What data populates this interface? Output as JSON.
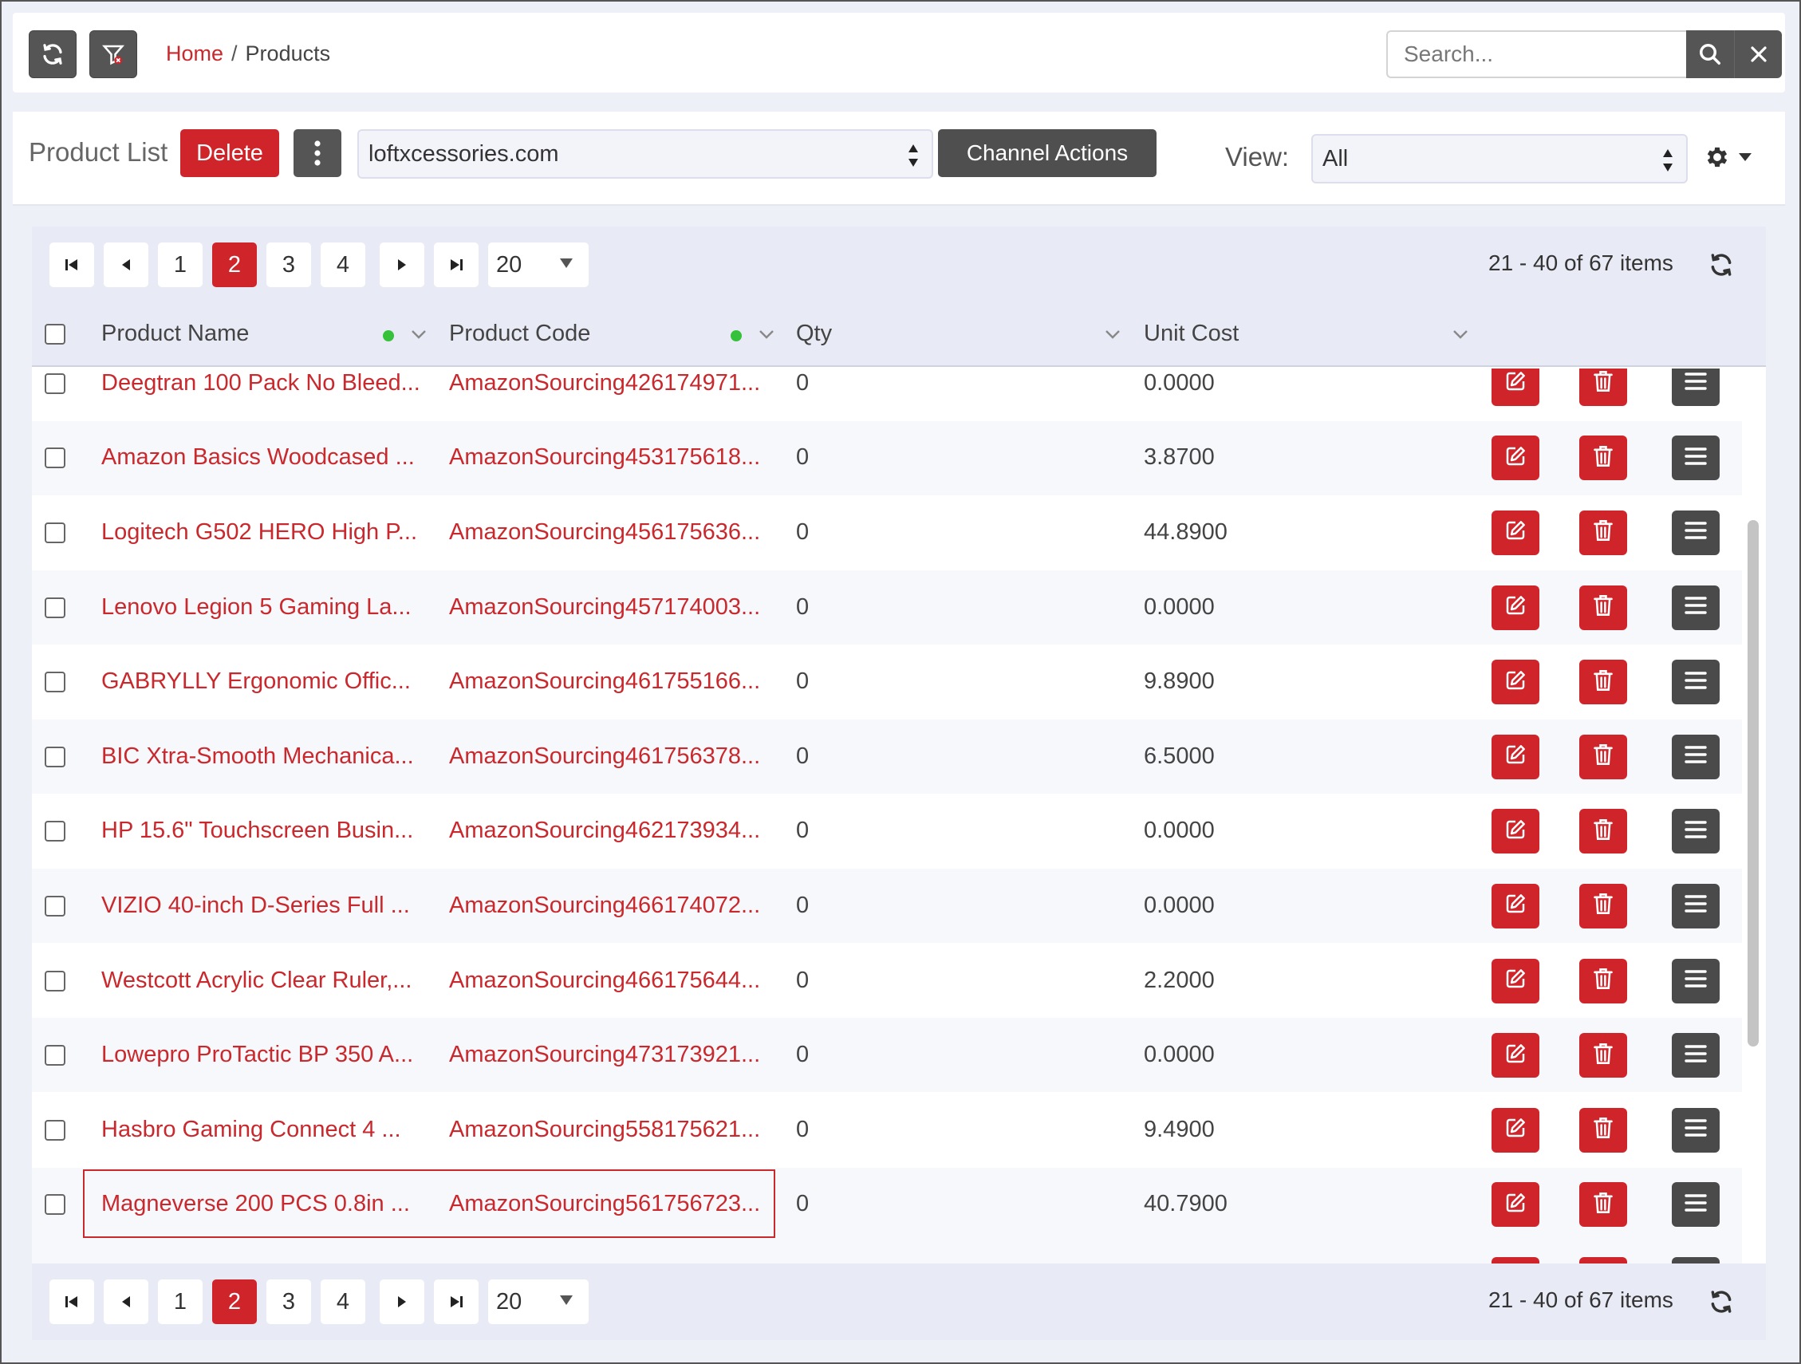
{
  "topbar": {
    "breadcrumb": {
      "home": "Home",
      "separator": "/",
      "current": "Products"
    },
    "search": {
      "placeholder": "Search...",
      "value": ""
    },
    "icons": [
      "refresh-icon",
      "filter-clear-icon",
      "search-icon",
      "close-icon"
    ]
  },
  "toolbar": {
    "title": "Product List",
    "delete_label": "Delete",
    "channel_select": "loftxcessories.com",
    "channel_actions_label": "Channel Actions",
    "view_label": "View:",
    "view_select": "All"
  },
  "pager": {
    "pages": [
      "1",
      "2",
      "3",
      "4"
    ],
    "active_page": "2",
    "page_size": "20",
    "info": "21 - 40 of 67 items"
  },
  "columns": {
    "name": "Product Name",
    "code": "Product Code",
    "qty": "Qty",
    "cost": "Unit Cost"
  },
  "rows": [
    {
      "name": "Deegtran 100 Pack No Bleed...",
      "code": "AmazonSourcing426174971...",
      "qty": "0",
      "cost": "0.0000"
    },
    {
      "name": "Amazon Basics Woodcased ...",
      "code": "AmazonSourcing453175618...",
      "qty": "0",
      "cost": "3.8700"
    },
    {
      "name": "Logitech G502 HERO High P...",
      "code": "AmazonSourcing456175636...",
      "qty": "0",
      "cost": "44.8900"
    },
    {
      "name": "Lenovo Legion 5 Gaming La...",
      "code": "AmazonSourcing457174003...",
      "qty": "0",
      "cost": "0.0000"
    },
    {
      "name": "GABRYLLY Ergonomic Offic...",
      "code": "AmazonSourcing461755166...",
      "qty": "0",
      "cost": "9.8900"
    },
    {
      "name": "BIC Xtra-Smooth Mechanica...",
      "code": "AmazonSourcing461756378...",
      "qty": "0",
      "cost": "6.5000"
    },
    {
      "name": "HP 15.6\" Touchscreen Busin...",
      "code": "AmazonSourcing462173934...",
      "qty": "0",
      "cost": "0.0000"
    },
    {
      "name": "VIZIO 40-inch D-Series Full ...",
      "code": "AmazonSourcing466174072...",
      "qty": "0",
      "cost": "0.0000"
    },
    {
      "name": "Westcott Acrylic Clear Ruler,...",
      "code": "AmazonSourcing466175644...",
      "qty": "0",
      "cost": "2.2000"
    },
    {
      "name": "Lowepro ProTactic BP 350 A...",
      "code": "AmazonSourcing473173921...",
      "qty": "0",
      "cost": "0.0000"
    },
    {
      "name": "Hasbro Gaming Connect 4 ...",
      "code": "AmazonSourcing558175621...",
      "qty": "0",
      "cost": "9.4900"
    },
    {
      "name": "Magneverse 200 PCS 0.8in ...",
      "code": "AmazonSourcing561756723...",
      "qty": "0",
      "cost": "40.7900"
    }
  ],
  "row_actions": [
    "edit-icon",
    "trash-icon",
    "menu-icon"
  ],
  "colors": {
    "accent": "#d0242b",
    "dark": "#4f4f4f",
    "link": "#c9282d",
    "sort_dot": "#35c13a"
  }
}
